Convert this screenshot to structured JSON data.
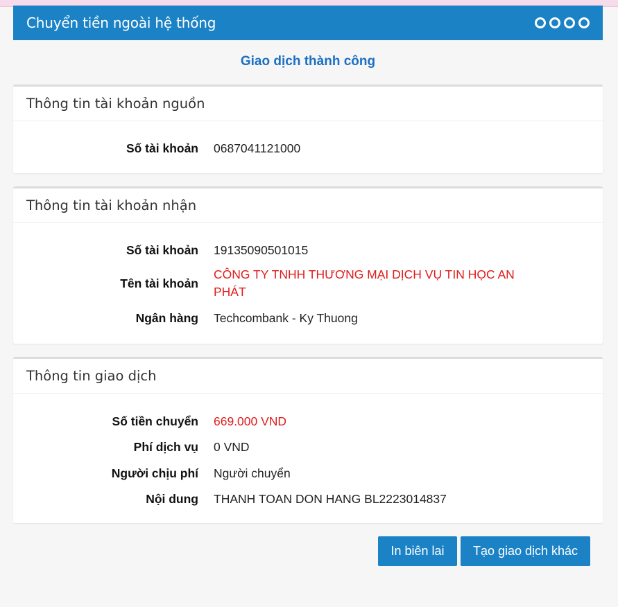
{
  "header": {
    "title": "Chuyển tiền ngoài hệ thống"
  },
  "status": "Giao dịch thành công",
  "source_panel": {
    "title": "Thông tin tài khoản nguồn",
    "rows": [
      {
        "label": "Số tài khoản",
        "value": "0687041121000"
      }
    ]
  },
  "receiver_panel": {
    "title": "Thông tin tài khoản nhận",
    "rows": [
      {
        "label": "Số tài khoản",
        "value": "19135090501015"
      },
      {
        "label": "Tên tài khoản",
        "value": "CÔNG TY TNHH THƯƠNG MẠI DỊCH VỤ TIN HỌC AN PHÁT"
      },
      {
        "label": "Ngân hàng",
        "value": "Techcombank - Ky Thuong"
      }
    ]
  },
  "transaction_panel": {
    "title": "Thông tin giao dịch",
    "rows": [
      {
        "label": "Số tiền chuyển",
        "value": "669.000 VND"
      },
      {
        "label": "Phí dịch vụ",
        "value": "0 VND"
      },
      {
        "label": "Người chịu phí",
        "value": "Người chuyển"
      },
      {
        "label": "Nội dung",
        "value": "THANH TOAN DON HANG BL2223014837"
      }
    ]
  },
  "buttons": {
    "print": "In biên lai",
    "new_transaction": "Tạo giao dịch khác"
  },
  "colors": {
    "primary": "#1b82c6",
    "status_text": "#1b6fc4",
    "highlight_red": "#e01b1b"
  }
}
